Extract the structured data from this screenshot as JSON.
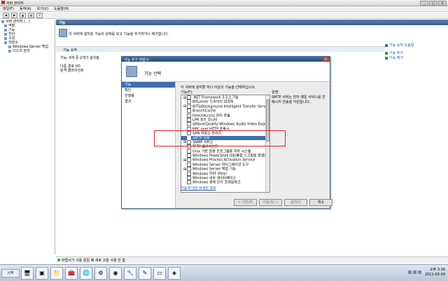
{
  "window": {
    "title": "서버 관리자",
    "buttons": [
      "_",
      "□",
      "X"
    ]
  },
  "menu": [
    "파일(F)",
    "동작(A)",
    "보기(V)",
    "도움말(H)"
  ],
  "toolbar_icons": [
    "back-icon",
    "forward-icon",
    "up-icon",
    "show-hide-icon",
    "help-icon"
  ],
  "tree": [
    {
      "label": "서버 관리자 (...)",
      "indent": 0
    },
    {
      "label": "역할",
      "indent": 1
    },
    {
      "label": "기능",
      "indent": 1
    },
    {
      "label": "진단",
      "indent": 1
    },
    {
      "label": "구성",
      "indent": 1
    },
    {
      "label": "저장소",
      "indent": 1
    },
    {
      "label": "Windows Server 백업",
      "indent": 2
    },
    {
      "label": "디스크 관리",
      "indent": 2
    }
  ],
  "center": {
    "header": "기능",
    "description": "이 서버에 설치된 기능의 상태를 보고 기능을 추가하거나 제거합니다.",
    "summary_header": "기능 요약",
    "summary_lines": [
      "기능: 9개 중 2개가 설치됨",
      "",
      "다중 경로 I/O",
      "원격 클라이언트"
    ]
  },
  "actions": {
    "help": "기능 요약 도움말",
    "items": [
      "기능 추가",
      "기능 제거"
    ]
  },
  "status": "마법사가 사용 중일 때 새로 고침 사용 안 함",
  "dialog": {
    "title": "기능 추가 마법사",
    "close": "X",
    "heading": "기능 선택",
    "nav": [
      "기능",
      "확인",
      "진행률",
      "결과"
    ],
    "nav_selected": 0,
    "instruction": "이 서버에 설치할 하나 이상의 기능을 선택하십시오.",
    "features_label": "기능(F):",
    "description_label": "설명:",
    "description": "SMTP 서버는 전자 메일 서비스를 간 메시지 전송을 지원합니다.",
    "features": [
      {
        "label": ".NET Framework 3.5.1 기능",
        "expand": true
      },
      {
        "label": "BitLocker 드라이브 암호화",
        "expand": false
      },
      {
        "label": "BITS(Background Intelligent Transfer Service)",
        "expand": true
      },
      {
        "label": "BranchCache",
        "expand": false
      },
      {
        "label": "DirectAccess 관리 콘솔",
        "expand": false
      },
      {
        "label": "LPR 포트 모니터",
        "expand": false
      },
      {
        "label": "qWave(Quality Windows Audio Video Experience)",
        "expand": false
      },
      {
        "label": "RPC over HTTP 프록시",
        "expand": false
      },
      {
        "label": "SAN 저장소 관리자",
        "expand": false
      },
      {
        "label": "SMTP 서버",
        "expand": false,
        "highlight": true
      },
      {
        "label": "SNMP 서비스",
        "expand": true
      },
      {
        "label": "TFTP 클라이언트",
        "expand": false
      },
      {
        "label": "Unix 기반 응용 프로그램용 하위 시스템",
        "expand": false
      },
      {
        "label": "Windows PowerShell ISE(통합 스크립팅 환경)",
        "expand": false
      },
      {
        "label": "Windows Process Activation Service",
        "expand": true
      },
      {
        "label": "Windows Server 마이그레이션 도구",
        "expand": false
      },
      {
        "label": "Windows Server 백업 기능",
        "expand": true
      },
      {
        "label": "Windows TIFF IFilter",
        "expand": false
      },
      {
        "label": "Windows 내부 데이터베이스",
        "expand": false
      },
      {
        "label": "Windows 생체 인식 프레임워크",
        "expand": false
      }
    ],
    "info_link": "기능에 대한 자세한 정보",
    "buttons": [
      {
        "label": "< 이전(P)",
        "enabled": false
      },
      {
        "label": "다음(N) >",
        "enabled": false
      },
      {
        "label": "설치(I)",
        "enabled": false
      },
      {
        "label": "취소",
        "enabled": true
      }
    ]
  },
  "taskbar": {
    "start": "시작",
    "tasks": [
      "server-manager-icon",
      "powershell-icon",
      "explorer-icon",
      "toolbox-icon",
      "network-icon",
      "settings-icon",
      "globe-icon",
      "tools-icon",
      "edit-icon",
      "terminal-icon",
      "app-icon"
    ],
    "time": "오후 3:16",
    "date": "2011-03-09"
  },
  "colors": {
    "accent": "#3d6fb0",
    "annotation": "#e02020",
    "title": "#24497a"
  }
}
